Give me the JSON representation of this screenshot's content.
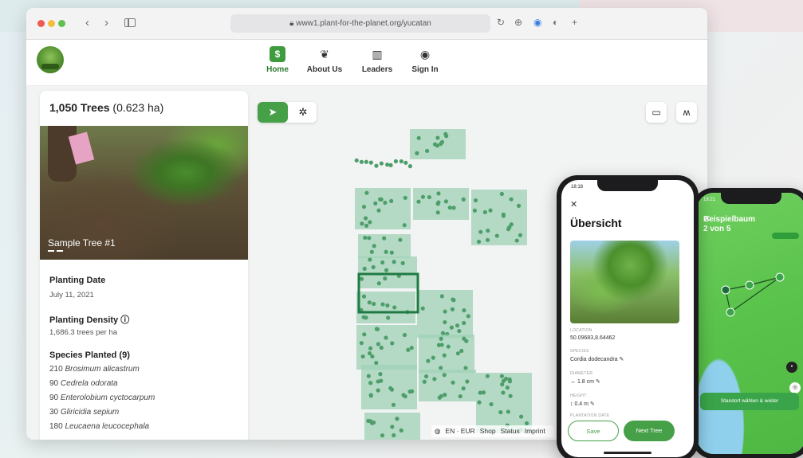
{
  "browser": {
    "url": "www1.plant-for-the-planet.org/yucatan"
  },
  "nav": {
    "items": [
      {
        "label": "Home",
        "icon": "dollar-badge-icon",
        "glyph": "$"
      },
      {
        "label": "About Us",
        "icon": "leaf-icon",
        "glyph": "❦"
      },
      {
        "label": "Leaders",
        "icon": "leaderboard-icon",
        "glyph": "▥"
      },
      {
        "label": "Sign In",
        "icon": "user-circle-icon",
        "glyph": "◉"
      }
    ]
  },
  "panel": {
    "trees": "1,050 Trees",
    "area": "(0.623 ha)",
    "photo_caption": "Sample Tree #1",
    "planting_date_label": "Planting Date",
    "planting_date": "July 11, 2021",
    "density_label": "Planting Density",
    "density_value": "1,686.3 trees per ha",
    "species_label": "Species Planted (9)",
    "species": [
      {
        "count": "210",
        "name": "Brosimum alicastrum"
      },
      {
        "count": "90",
        "name": "Cedrela odorata"
      },
      {
        "count": "90",
        "name": "Enterolobium cyctocarpum"
      },
      {
        "count": "30",
        "name": "Gliricidia sepium"
      },
      {
        "count": "180",
        "name": "Leucaena leucocephala"
      }
    ]
  },
  "map": {
    "footer": [
      "EN · EUR",
      "Shop",
      "Status",
      "Imprint"
    ]
  },
  "phone1": {
    "time": "18:18",
    "title": "Übersicht",
    "location_label": "LOCATION",
    "location": "50.09683,8.64462",
    "species_label": "SPECIES",
    "species": "Cordia dodecandra",
    "diameter_label": "DIAMETER",
    "diameter": "↔ 1.8 cm",
    "height_label": "HEIGHT",
    "height": "↕ 0.4 m",
    "plantation_label": "PLANTATION DATE",
    "save": "Save",
    "next": "Next Tree"
  },
  "phone2": {
    "time": "18:21",
    "title_line1": "Beispielbaum",
    "title_line2": "2 von 5",
    "cta": "Standort wählen & weiter"
  },
  "colors": {
    "brand_green": "#46a047",
    "plot_fill": "#9fd2b5",
    "tree_dot": "#4e9e6b"
  }
}
